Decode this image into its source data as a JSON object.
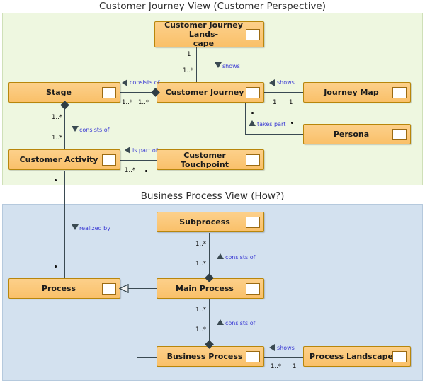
{
  "diagram": {
    "title_top": "Customer Journey View (Customer Perspective)",
    "title_bottom": "Business Process View (How?)",
    "colors": {
      "customer_panel_bg": "#eef7e0",
      "business_panel_bg": "#d3e1ef",
      "node_fill": "#fbc87c",
      "node_border": "#b8860b",
      "connector": "#3a4a52",
      "relation_label": "#3b3bd4"
    }
  },
  "customer_journey_view": {
    "title": "Customer Journey View (Customer Perspective)",
    "nodes": [
      {
        "id": "cjl",
        "label": "Customer Journey Lands-\ncape",
        "icon": "business-object-icon"
      },
      {
        "id": "stage",
        "label": "Stage",
        "icon": "business-object-icon"
      },
      {
        "id": "cj",
        "label": "Customer Journey",
        "icon": "business-object-icon"
      },
      {
        "id": "jmap",
        "label": "Journey Map",
        "icon": "business-object-icon"
      },
      {
        "id": "persona",
        "label": "Persona",
        "icon": "business-object-icon"
      },
      {
        "id": "cactivity",
        "label": "Customer Activity",
        "icon": "business-object-icon"
      },
      {
        "id": "ctouch",
        "label": "Customer Touchpoint",
        "icon": "business-object-icon"
      }
    ],
    "relations": [
      {
        "from": "cjl",
        "to": "cj",
        "label": "shows",
        "marker": "down",
        "source_card": "1",
        "target_card": "1..*"
      },
      {
        "from": "cj",
        "to": "stage",
        "label": "consists of",
        "marker": "left",
        "source_card": "1..*",
        "target_card": "1..*"
      },
      {
        "from": "jmap",
        "to": "cj",
        "label": "shows",
        "marker": "left",
        "source_card": "1",
        "target_card": "1"
      },
      {
        "from": "persona",
        "to": "cj",
        "label": "takes part",
        "marker": "up",
        "source_card": "*",
        "target_card": "*"
      },
      {
        "from": "stage",
        "to": "cactivity",
        "label": "consists of",
        "marker": "down",
        "source_card": "1..*",
        "target_card": "1..*"
      },
      {
        "from": "ctouch",
        "to": "cactivity",
        "label": "is part of",
        "marker": "left",
        "source_card": "1..*",
        "target_card": "*"
      }
    ]
  },
  "business_process_view": {
    "title": "Business Process View (How?)",
    "nodes": [
      {
        "id": "subprocess",
        "label": "Subprocess",
        "icon": "business-object-icon"
      },
      {
        "id": "process",
        "label": "Process",
        "icon": "business-object-icon"
      },
      {
        "id": "mainproc",
        "label": "Main Process",
        "icon": "business-object-icon"
      },
      {
        "id": "bizproc",
        "label": "Business Process",
        "icon": "business-object-icon"
      },
      {
        "id": "plandscape",
        "label": "Process Landscape",
        "icon": "business-object-icon"
      }
    ],
    "relations": [
      {
        "from": "mainproc",
        "to": "subprocess",
        "label": "consists of",
        "marker": "up",
        "source_card": "1..*",
        "target_card": "1..*"
      },
      {
        "from": "bizproc",
        "to": "mainproc",
        "label": "consists of",
        "marker": "up",
        "source_card": "1..*",
        "target_card": "1..*"
      },
      {
        "from": "plandscape",
        "to": "bizproc",
        "label": "shows",
        "marker": "left",
        "source_card": "1..*",
        "target_card": "1"
      },
      {
        "from": "mainproc",
        "to": "process",
        "label": "",
        "marker": "generalization",
        "source_card": "",
        "target_card": ""
      },
      {
        "from": "subprocess",
        "to": "bizproc",
        "label": "",
        "marker": "routed",
        "source_card": "",
        "target_card": ""
      }
    ]
  },
  "cross_view_relation": {
    "from": "cactivity",
    "to": "process",
    "label": "realized by",
    "marker": "down",
    "source_card": "*",
    "target_card": "*"
  },
  "labels": {
    "consists_of": "consists of",
    "shows": "shows",
    "is_part_of": "is part of",
    "takes_part": "takes part",
    "realized_by": "realized by",
    "one": "1",
    "one_to_many": "1..*",
    "many": "*"
  }
}
